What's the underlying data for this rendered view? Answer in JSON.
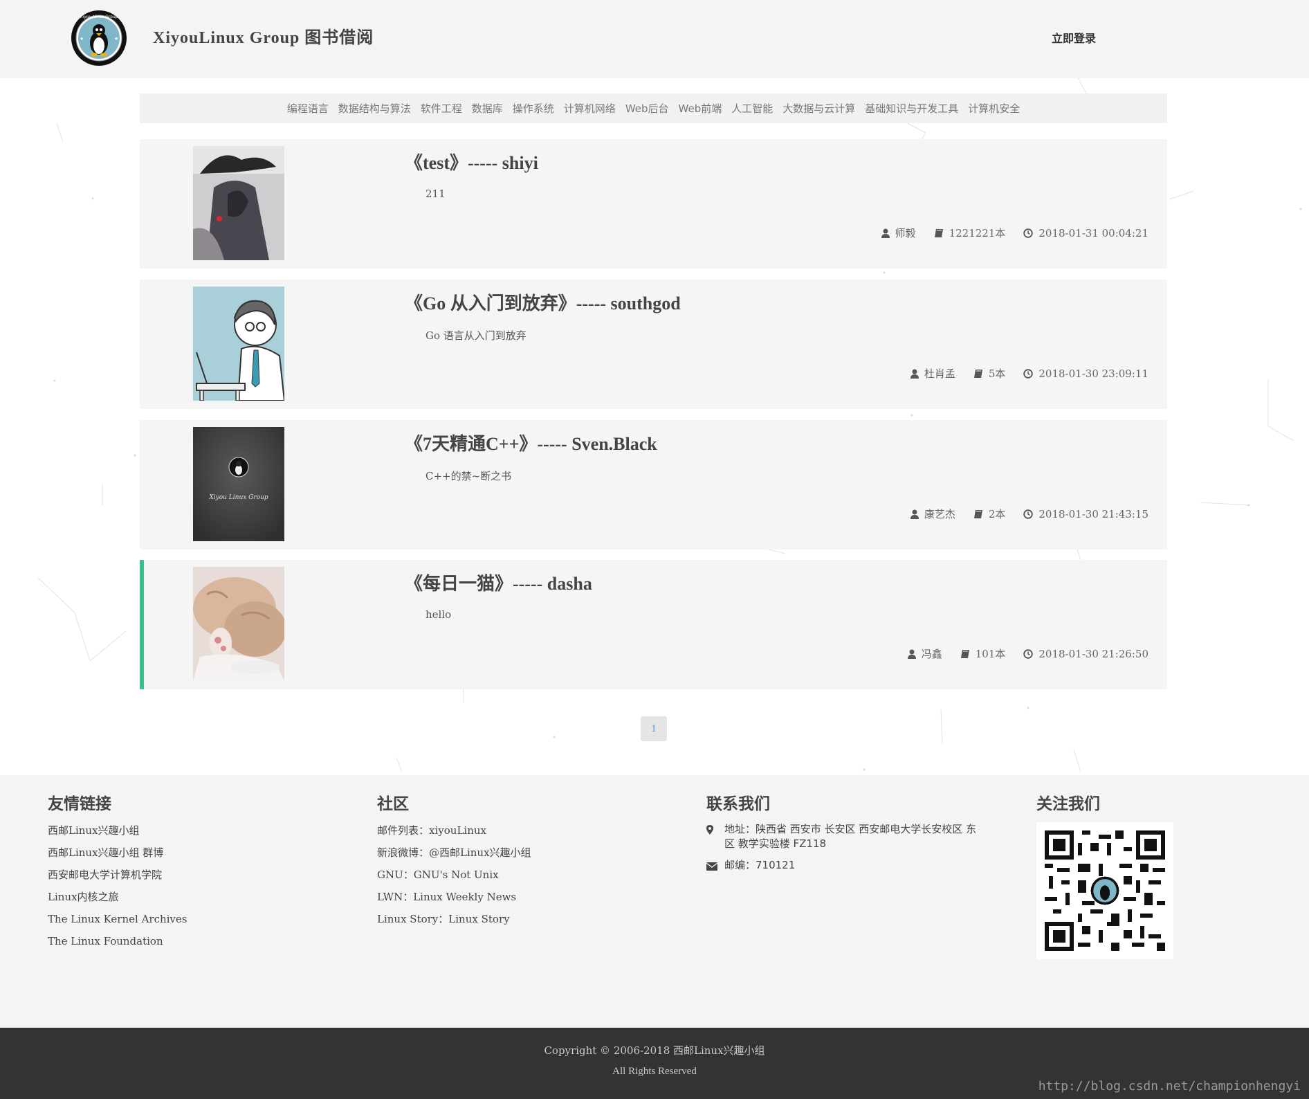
{
  "header": {
    "site_title": "XiyouLinux Group 图书借阅",
    "login_label": "立即登录"
  },
  "categories": [
    "编程语言",
    "数据结构与算法",
    "软件工程",
    "数据库",
    "操作系统",
    "计算机网络",
    "Web后台",
    "Web前端",
    "人工智能",
    "大数据与云计算",
    "基础知识与开发工具",
    "计算机安全"
  ],
  "books": [
    {
      "title": "《test》----- shiyi",
      "desc": "211",
      "owner": "师毅",
      "count": "1221221本",
      "time": "2018-01-31 00:04:21",
      "cover": "dark-art"
    },
    {
      "title": "《Go 从入门到放弃》----- southgod",
      "desc": "Go 语言从入门到放弃",
      "owner": "杜肖孟",
      "count": "5本",
      "time": "2018-01-30 23:09:11",
      "cover": "cartoon-programmer"
    },
    {
      "title": "《7天精通C++》----- Sven.Black",
      "desc": "C++的禁~断之书",
      "owner": "康艺杰",
      "count": "2本",
      "time": "2018-01-30 21:43:15",
      "cover": "xiyou-logo-dark"
    },
    {
      "title": "《每日一猫》----- dasha",
      "desc": "hello",
      "owner": "冯鑫",
      "count": "101本",
      "time": "2018-01-30 21:26:50",
      "cover": "sleeping-cat"
    }
  ],
  "pagination": {
    "current": "1"
  },
  "footer": {
    "friends": {
      "heading": "友情链接",
      "links": [
        "西邮Linux兴趣小组",
        "西邮Linux兴趣小组 群博",
        "西安邮电大学计算机学院",
        "Linux内核之旅",
        "The Linux Kernel Archives",
        "The Linux Foundation"
      ]
    },
    "community": {
      "heading": "社区",
      "items": [
        {
          "k": "邮件列表：",
          "v": "xiyouLinux"
        },
        {
          "k": "新浪微博：",
          "v": "@西邮Linux兴趣小组"
        },
        {
          "k": "GNU：",
          "v": "GNU's Not Unix"
        },
        {
          "k": "LWN：",
          "v": "Linux Weekly News"
        },
        {
          "k": "Linux Story：",
          "v": "Linux Story"
        }
      ]
    },
    "contact": {
      "heading": "联系我们",
      "address": "地址：陕西省 西安市 长安区 西安邮电大学长安校区 东区 教学实验楼 FZ118",
      "postcode": "邮编：710121"
    },
    "follow": {
      "heading": "关注我们"
    }
  },
  "bottom": {
    "copyright": "Copyright © 2006-2018 西邮Linux兴趣小组",
    "rights": "All Rights Reserved",
    "watermark": "http://blog.csdn.net/championhengyi"
  },
  "colors": {
    "accent": "#3fbf8e",
    "pager_text": "#5a8fd0",
    "footer_bg": "#333333"
  },
  "icons": {
    "owner": "user-icon",
    "count": "book-icon",
    "time": "clock-icon",
    "address": "map-marker-icon",
    "postcode": "envelope-icon"
  }
}
